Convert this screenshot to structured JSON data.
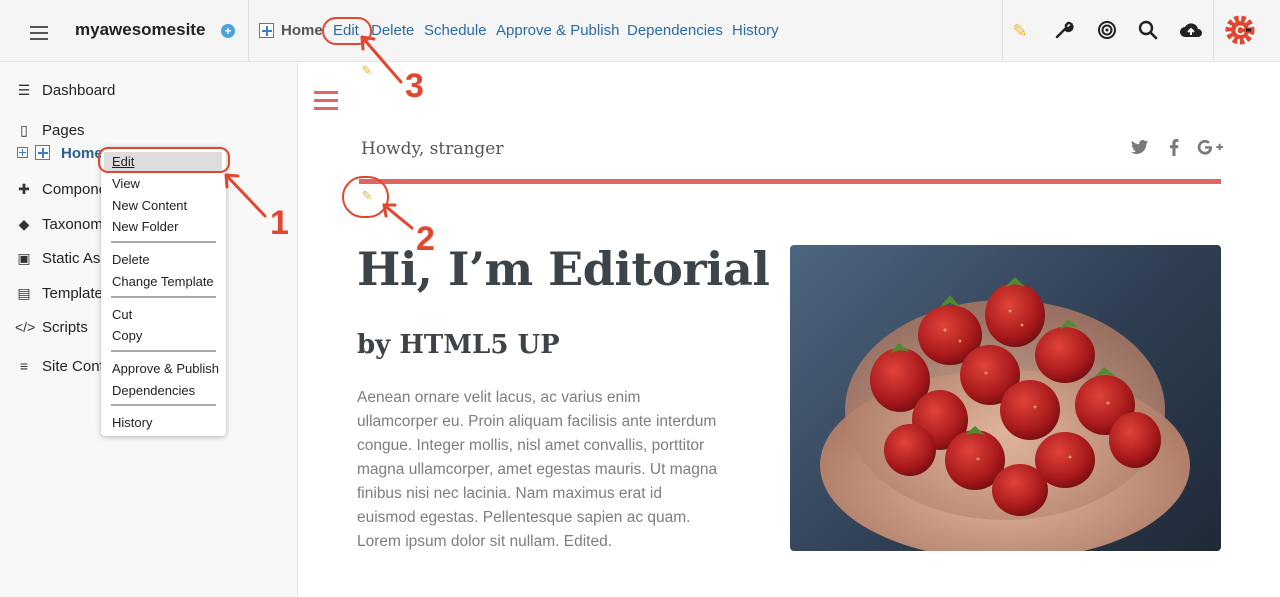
{
  "header": {
    "site_name": "myawesomesite",
    "breadcrumb_home": "Home",
    "links": [
      "Edit",
      "Delete",
      "Schedule",
      "Approve & Publish",
      "Dependencies",
      "History"
    ],
    "tool_icons": [
      "pencil-icon",
      "wrench-icon",
      "target-icon",
      "search-icon",
      "cloud-upload-icon",
      "crafter-logo"
    ],
    "accent_color": "#e2462f"
  },
  "sidebar": {
    "items": [
      {
        "label": "Dashboard",
        "icon": "dashboard-icon"
      },
      {
        "label": "Pages",
        "icon": "page-icon"
      },
      {
        "label": "Components",
        "icon": "puzzle-icon"
      },
      {
        "label": "Taxonomy",
        "icon": "tag-icon"
      },
      {
        "label": "Static Assets",
        "icon": "image-icon"
      },
      {
        "label": "Templates",
        "icon": "template-icon"
      },
      {
        "label": "Scripts",
        "icon": "code-icon"
      },
      {
        "label": "Site Config",
        "icon": "sliders-icon"
      }
    ],
    "tree_home": "Home"
  },
  "context_menu": {
    "items": [
      "Edit",
      "View",
      "New Content",
      "New Folder",
      "Delete",
      "Change Template",
      "Cut",
      "Copy",
      "Approve & Publish",
      "Dependencies",
      "History"
    ]
  },
  "preview": {
    "greeting": "Howdy, stranger",
    "title": "Hi, I’m Editorial",
    "subtitle": "by HTML5 UP",
    "body_lines": [
      "Aenean ornare velit lacus, ac varius enim",
      "ullamcorper eu. Proin aliquam facilisis ante interdum",
      "congue. Integer mollis, nisl amet convallis, porttitor",
      "magna ullamcorper, amet egestas mauris. Ut magna",
      "finibus nisi nec lacinia. Nam maximus erat id",
      "euismod egestas. Pellentesque sapien ac quam.",
      "Lorem ipsum dolor sit nullam. Edited."
    ],
    "social": [
      "twitter-icon",
      "facebook-icon",
      "google-plus-icon"
    ],
    "accent_color": "#e06565"
  },
  "annotations": {
    "one": "1",
    "two": "2",
    "three": "3"
  }
}
